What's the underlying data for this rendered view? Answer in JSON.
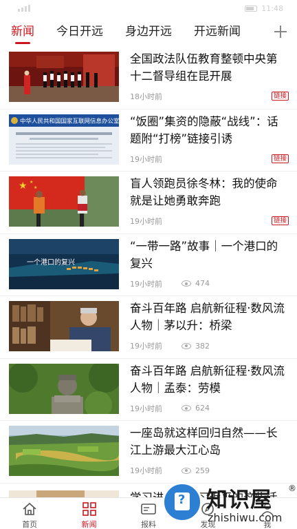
{
  "status_bar": {
    "time": "11:48"
  },
  "tabs": [
    {
      "label": "新闻",
      "active": true
    },
    {
      "label": "今日开远",
      "active": false
    },
    {
      "label": "身边开远",
      "active": false
    },
    {
      "label": "开远新闻",
      "active": false
    }
  ],
  "tab_add_icon": "plus-icon",
  "feed": [
    {
      "title": "全国政法队伍教育整顿中央第十二督导组在昆开展",
      "time": "18小时前",
      "badge": "链接"
    },
    {
      "title": "“饭圈”集资的隐蔽“战线”：话题附“打榜”链接引诱",
      "time": "19小时前",
      "badge": "链接"
    },
    {
      "title": "盲人领跑员徐冬林：我的使命就是让她勇敢奔跑",
      "time": "19小时前",
      "badge": "链接"
    },
    {
      "title": "“一带一路”故事｜一个港口的复兴",
      "time": "19小时前",
      "views": "474"
    },
    {
      "title": "奋斗百年路 启航新征程·数风流人物｜茅以升：桥梁",
      "time": "19小时前",
      "views": "382"
    },
    {
      "title": "奋斗百年路 启航新征程·数风流人物｜孟泰：劳模",
      "time": "19小时前",
      "views": "624"
    },
    {
      "title": "一座岛就这样回归自然——长江上游最大江心岛",
      "time": "19小时前",
      "views": "259"
    },
    {
      "title": "学习进行时｜习近平的这些话",
      "time": "",
      "views": ""
    }
  ],
  "thumb_texts": {
    "item2_header": "中华人民共和国国家互联网信息办公室",
    "item4_caption": "一个港口的复兴"
  },
  "bottom_nav": [
    {
      "label": "首页",
      "icon": "home-icon",
      "active": false
    },
    {
      "label": "新闻",
      "icon": "grid-icon",
      "active": true
    },
    {
      "label": "报料",
      "icon": "card-icon",
      "active": false
    },
    {
      "label": "发现",
      "icon": "discover-icon",
      "active": false
    },
    {
      "label": "我",
      "icon": "user-icon",
      "active": false
    }
  ],
  "watermark": {
    "title": "知识屋",
    "reg": "®",
    "url": "zhishiwu.com"
  },
  "colors": {
    "accent": "#c9171e",
    "watermark_blue": "#2c7fd2"
  }
}
